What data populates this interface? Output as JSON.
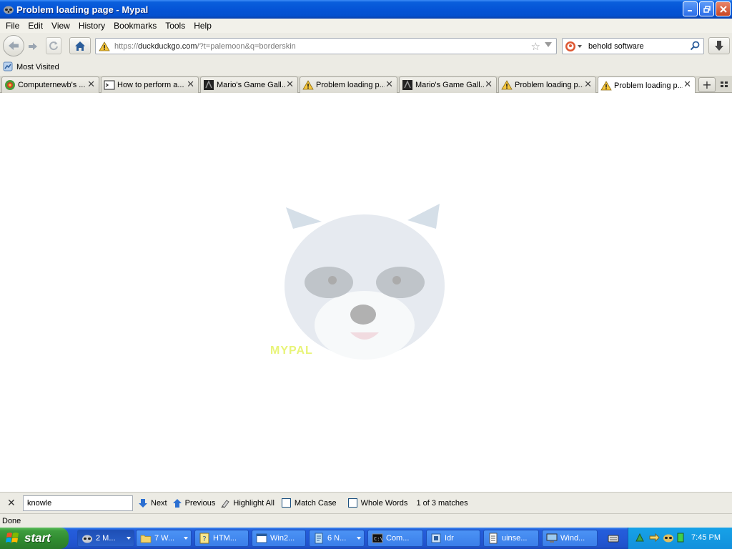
{
  "window": {
    "title": "Problem loading page - Mypal"
  },
  "menu": [
    "File",
    "Edit",
    "View",
    "History",
    "Bookmarks",
    "Tools",
    "Help"
  ],
  "nav": {
    "url_prefix": "https://",
    "url_host": "duckduckgo.com",
    "url_path": "/?t=palemoon&q=borderskin",
    "search_query": "behold software"
  },
  "bookmarks": {
    "most_visited": "Most Visited"
  },
  "tabs": [
    {
      "label": "Computernewb's ..."
    },
    {
      "label": "How to perform a..."
    },
    {
      "label": "Mario's Game Gall..."
    },
    {
      "label": "Problem loading p..."
    },
    {
      "label": "Mario's Game Gall..."
    },
    {
      "label": "Problem loading p..."
    },
    {
      "label": "Problem loading p..."
    }
  ],
  "content": {
    "watermark_text": "MYPAL"
  },
  "findbar": {
    "query": "knowle",
    "next": "Next",
    "previous": "Previous",
    "highlight_all": "Highlight All",
    "match_case": "Match Case",
    "whole_words": "Whole Words",
    "status": "1 of 3 matches"
  },
  "status": {
    "text": "Done"
  },
  "taskbar": {
    "start": "start",
    "tasks": [
      {
        "label": "2 M..."
      },
      {
        "label": "7 W..."
      },
      {
        "label": "HTM..."
      },
      {
        "label": "Win2..."
      },
      {
        "label": "6 N..."
      },
      {
        "label": "Com..."
      },
      {
        "label": "Idr"
      },
      {
        "label": "uinse..."
      },
      {
        "label": "Wind..."
      }
    ],
    "clock": "7:45 PM"
  }
}
